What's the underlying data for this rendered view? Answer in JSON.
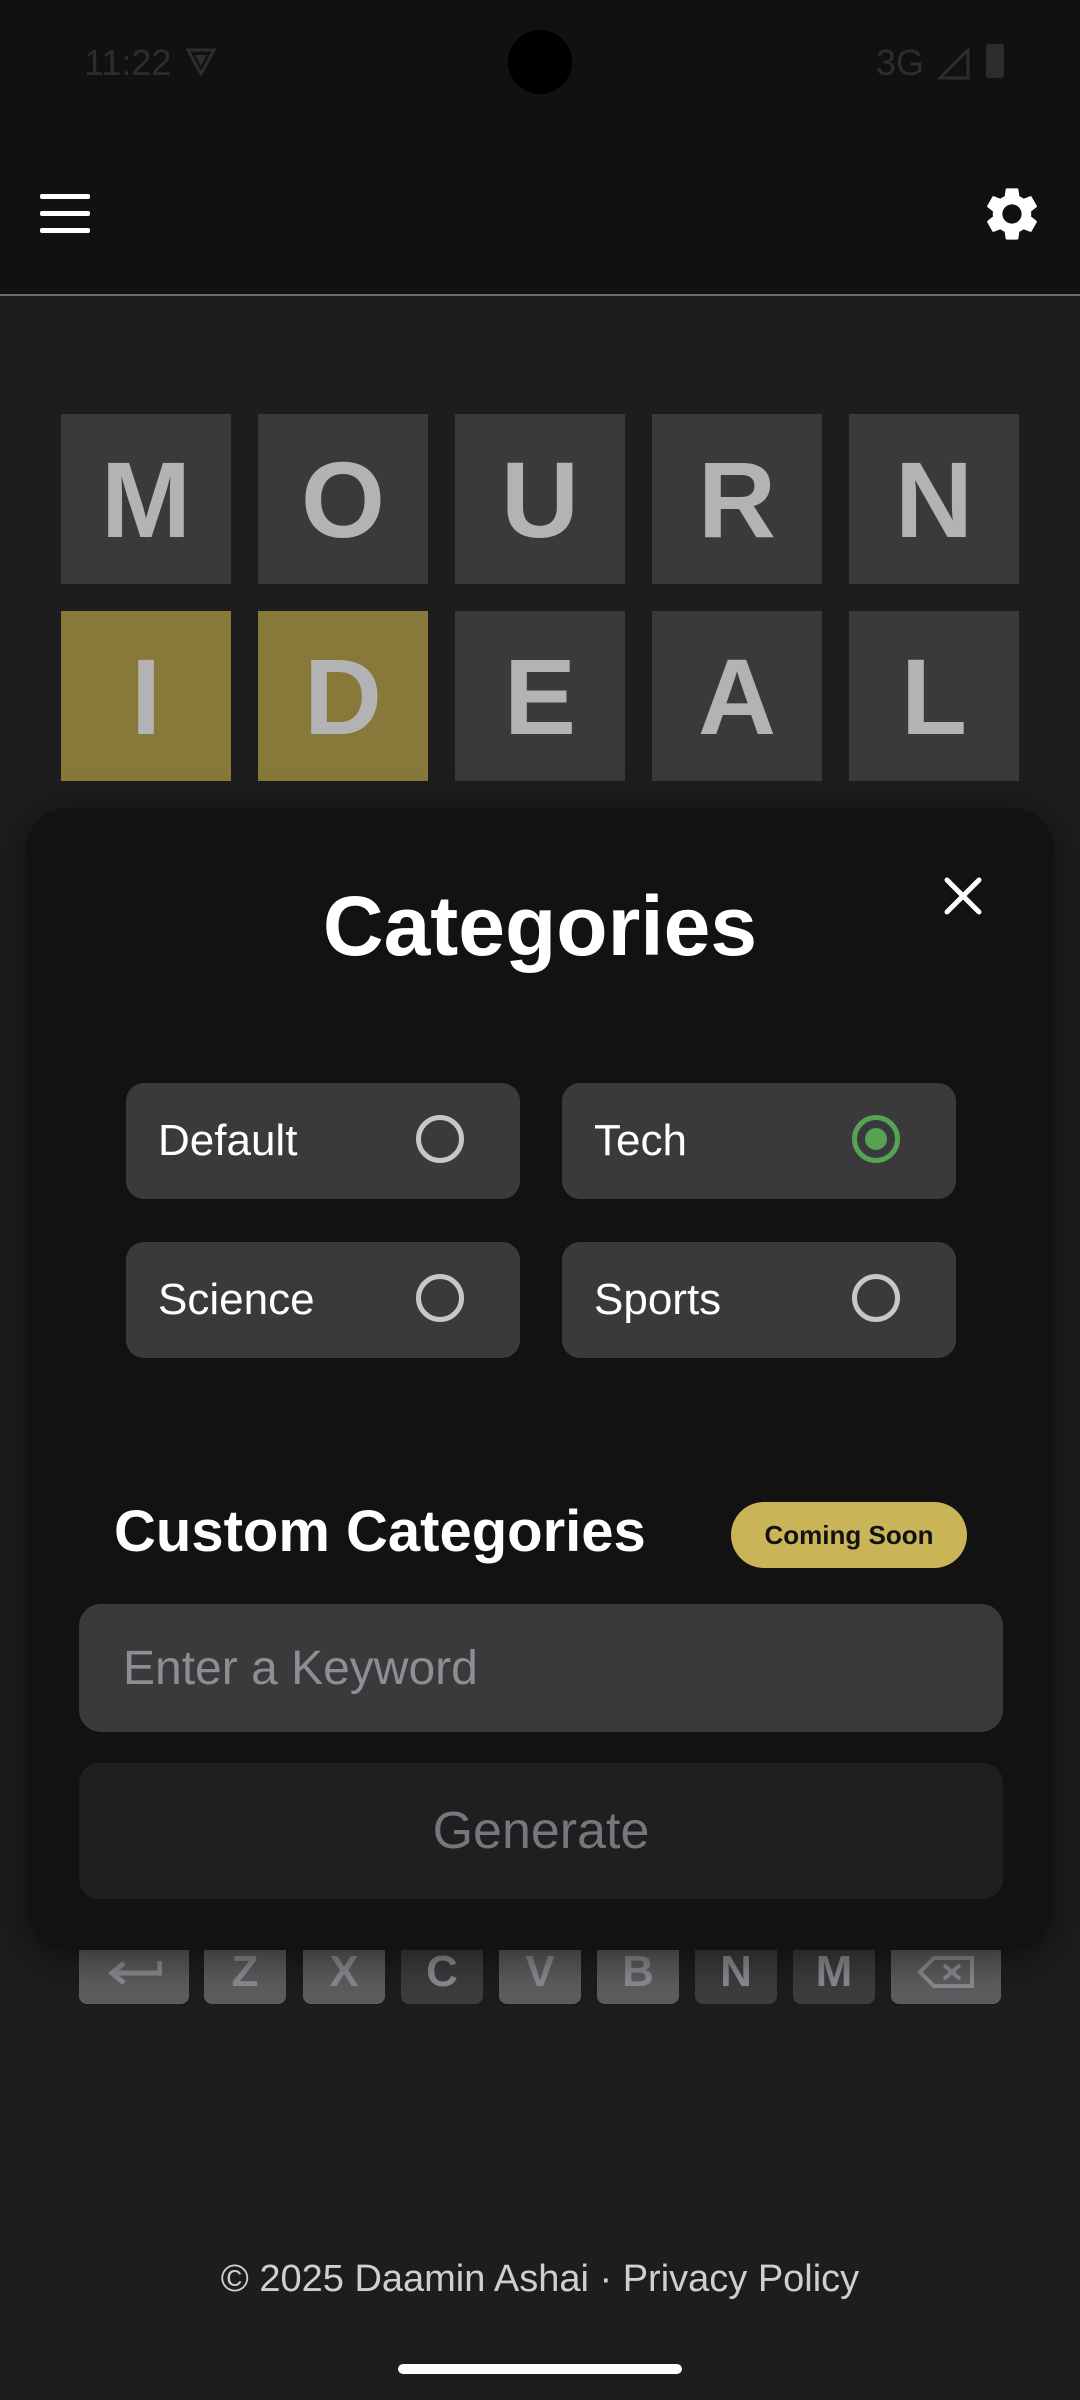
{
  "status": {
    "time": "11:22",
    "network": "3G"
  },
  "board": {
    "rows": [
      {
        "letters": [
          "M",
          "O",
          "U",
          "R",
          "N"
        ],
        "states": [
          "absent",
          "absent",
          "absent",
          "absent",
          "absent"
        ]
      },
      {
        "letters": [
          "I",
          "D",
          "E",
          "A",
          "L"
        ],
        "states": [
          "present",
          "present",
          "absent",
          "absent",
          "absent"
        ]
      }
    ]
  },
  "keyboard": {
    "visible_row": [
      "Z",
      "X",
      "C",
      "V",
      "B",
      "N",
      "M"
    ]
  },
  "modal": {
    "title": "Categories",
    "options": [
      {
        "label": "Default",
        "selected": false
      },
      {
        "label": "Tech",
        "selected": true
      },
      {
        "label": "Science",
        "selected": false
      },
      {
        "label": "Sports",
        "selected": false
      }
    ],
    "custom_title": "Custom Categories",
    "badge": "Coming Soon",
    "keyword_placeholder": "Enter a Keyword",
    "generate_label": "Generate"
  },
  "footer": {
    "copyright": "© 2025 Daamin Ashai",
    "separator": " · ",
    "privacy": "Privacy Policy"
  },
  "colors": {
    "background": "#1d1d1f",
    "tile_absent": "#3a3a3c",
    "tile_present": "#867939",
    "accent_selected": "#56a353",
    "badge": "#c9b458"
  }
}
